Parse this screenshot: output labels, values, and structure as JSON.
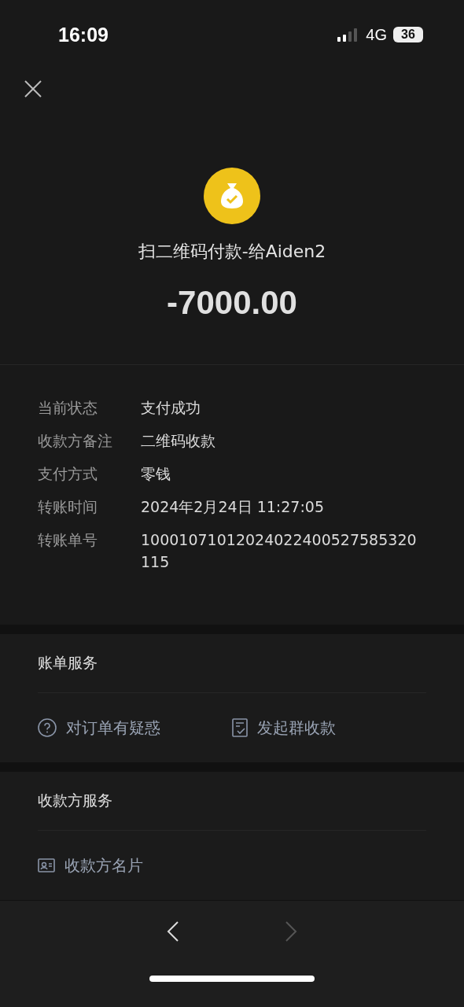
{
  "status_bar": {
    "time": "16:09",
    "network": "4G",
    "battery": "36"
  },
  "header": {
    "title": "扫二维码付款-给Aiden2",
    "amount": "-7000.00"
  },
  "details": [
    {
      "label": "当前状态",
      "value": "支付成功"
    },
    {
      "label": "收款方备注",
      "value": "二维码收款"
    },
    {
      "label": "支付方式",
      "value": "零钱"
    },
    {
      "label": "转账时间",
      "value": "2024年2月24日 11:27:05"
    },
    {
      "label": "转账单号",
      "value": "10001071012024022400527585320115"
    }
  ],
  "sections": [
    {
      "title": "账单服务",
      "actions": [
        {
          "kind": "question",
          "label": "对订单有疑惑"
        },
        {
          "kind": "receipt",
          "label": "发起群收款"
        }
      ]
    },
    {
      "title": "收款方服务",
      "actions": [
        {
          "kind": "card",
          "label": "收款方名片"
        }
      ]
    }
  ],
  "nav": {
    "back_disabled": false,
    "forward_disabled": true
  }
}
